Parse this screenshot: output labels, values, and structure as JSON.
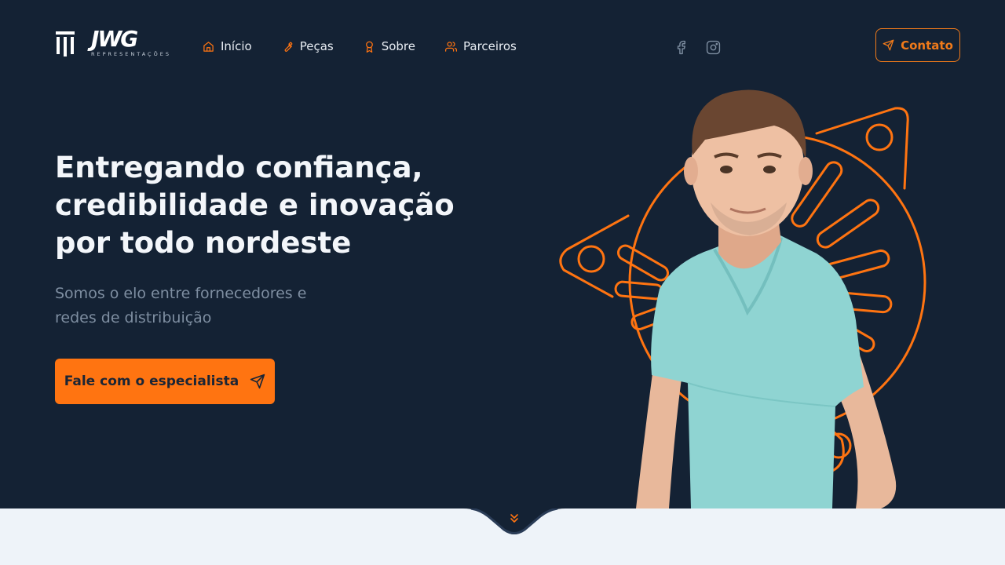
{
  "header": {
    "logo": {
      "wordmark": "JWG",
      "tagline": "REPRESENTAÇÕES"
    },
    "nav": [
      {
        "label": "Início",
        "icon": "home-icon"
      },
      {
        "label": "Peças",
        "icon": "wrench-icon"
      },
      {
        "label": "Sobre",
        "icon": "award-icon"
      },
      {
        "label": "Parceiros",
        "icon": "users-icon"
      }
    ],
    "social": [
      "facebook-icon",
      "instagram-icon"
    ],
    "contact_button": {
      "label": "Contato",
      "icon": "send-icon"
    }
  },
  "hero": {
    "headline": "Entregando confiança, credibilidade e inovação por todo nordeste",
    "subheadline": "Somos o elo entre fornecedores e redes de distribuição",
    "cta": {
      "label": "Fale com o especialista",
      "icon": "send-icon"
    },
    "scroll_icon": "chevrons-down-icon"
  },
  "colors": {
    "background": "#142234",
    "accent": "#ff7411",
    "section_below": "#eef3f9"
  }
}
